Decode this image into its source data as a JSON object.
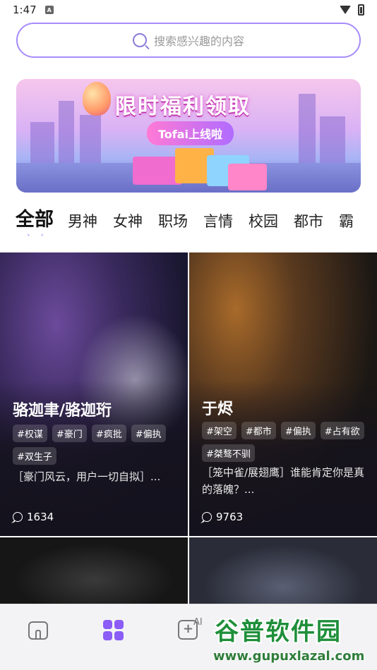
{
  "status": {
    "time": "1:47",
    "sim_badge": "A"
  },
  "search": {
    "placeholder": "搜索感兴趣的内容"
  },
  "banner": {
    "title": "限时福利领取",
    "pill": "Tofai上线啦"
  },
  "tabs": [
    "全部",
    "男神",
    "女神",
    "职场",
    "言情",
    "校园",
    "都市",
    "霸"
  ],
  "cards": [
    {
      "name": "骆迦聿/骆迦珩",
      "tags": [
        "#权谋",
        "#豪门",
        "#疯批",
        "#偏执",
        "#双生子"
      ],
      "desc": "［豪门风云，用户一切自拟］...",
      "count": "1634"
    },
    {
      "name": "于烬",
      "tags": [
        "#架空",
        "#都市",
        "#偏执",
        "#占有欲",
        "#桀骜不驯"
      ],
      "desc": "［笼中雀/展翅鹰］谁能肯定你是真的落魄？...",
      "count": "9763"
    }
  ],
  "bottom_nav": {
    "ai_label": "AI"
  },
  "watermark": {
    "title": "谷普软件园",
    "url": "www.gupuxlazal.com"
  },
  "colors": {
    "accent": "#8b5cf6",
    "watermark_green": "#1f8f3a"
  }
}
